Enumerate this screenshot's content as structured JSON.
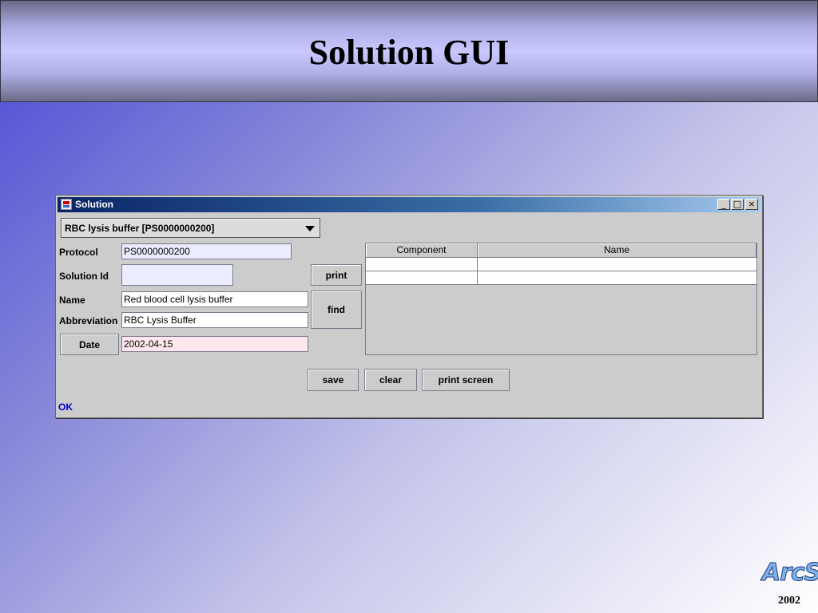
{
  "slide": {
    "title": "Solution GUI",
    "logo": "ArcS",
    "year": "2002"
  },
  "window": {
    "title": "Solution",
    "controls": {
      "minimize": "_",
      "maximize": "□",
      "close": "×"
    }
  },
  "combo": {
    "selected": "RBC lysis buffer [PS0000000200]"
  },
  "form": {
    "protocol_label": "Protocol",
    "protocol_value": "PS0000000200",
    "solution_id_label": "Solution Id",
    "solution_id_value": "",
    "name_label": "Name",
    "name_value": "Red blood cell lysis buffer",
    "abbreviation_label": "Abbreviation",
    "abbreviation_value": "RBC Lysis Buffer",
    "date_button": "Date",
    "date_value": "2002-04-15"
  },
  "buttons": {
    "print": "print",
    "find": "find",
    "save": "save",
    "clear": "clear",
    "print_screen": "print screen"
  },
  "table": {
    "columns": [
      "Component",
      "Name"
    ],
    "rows": [
      [
        "",
        ""
      ],
      [
        "",
        ""
      ]
    ]
  },
  "status": "OK"
}
